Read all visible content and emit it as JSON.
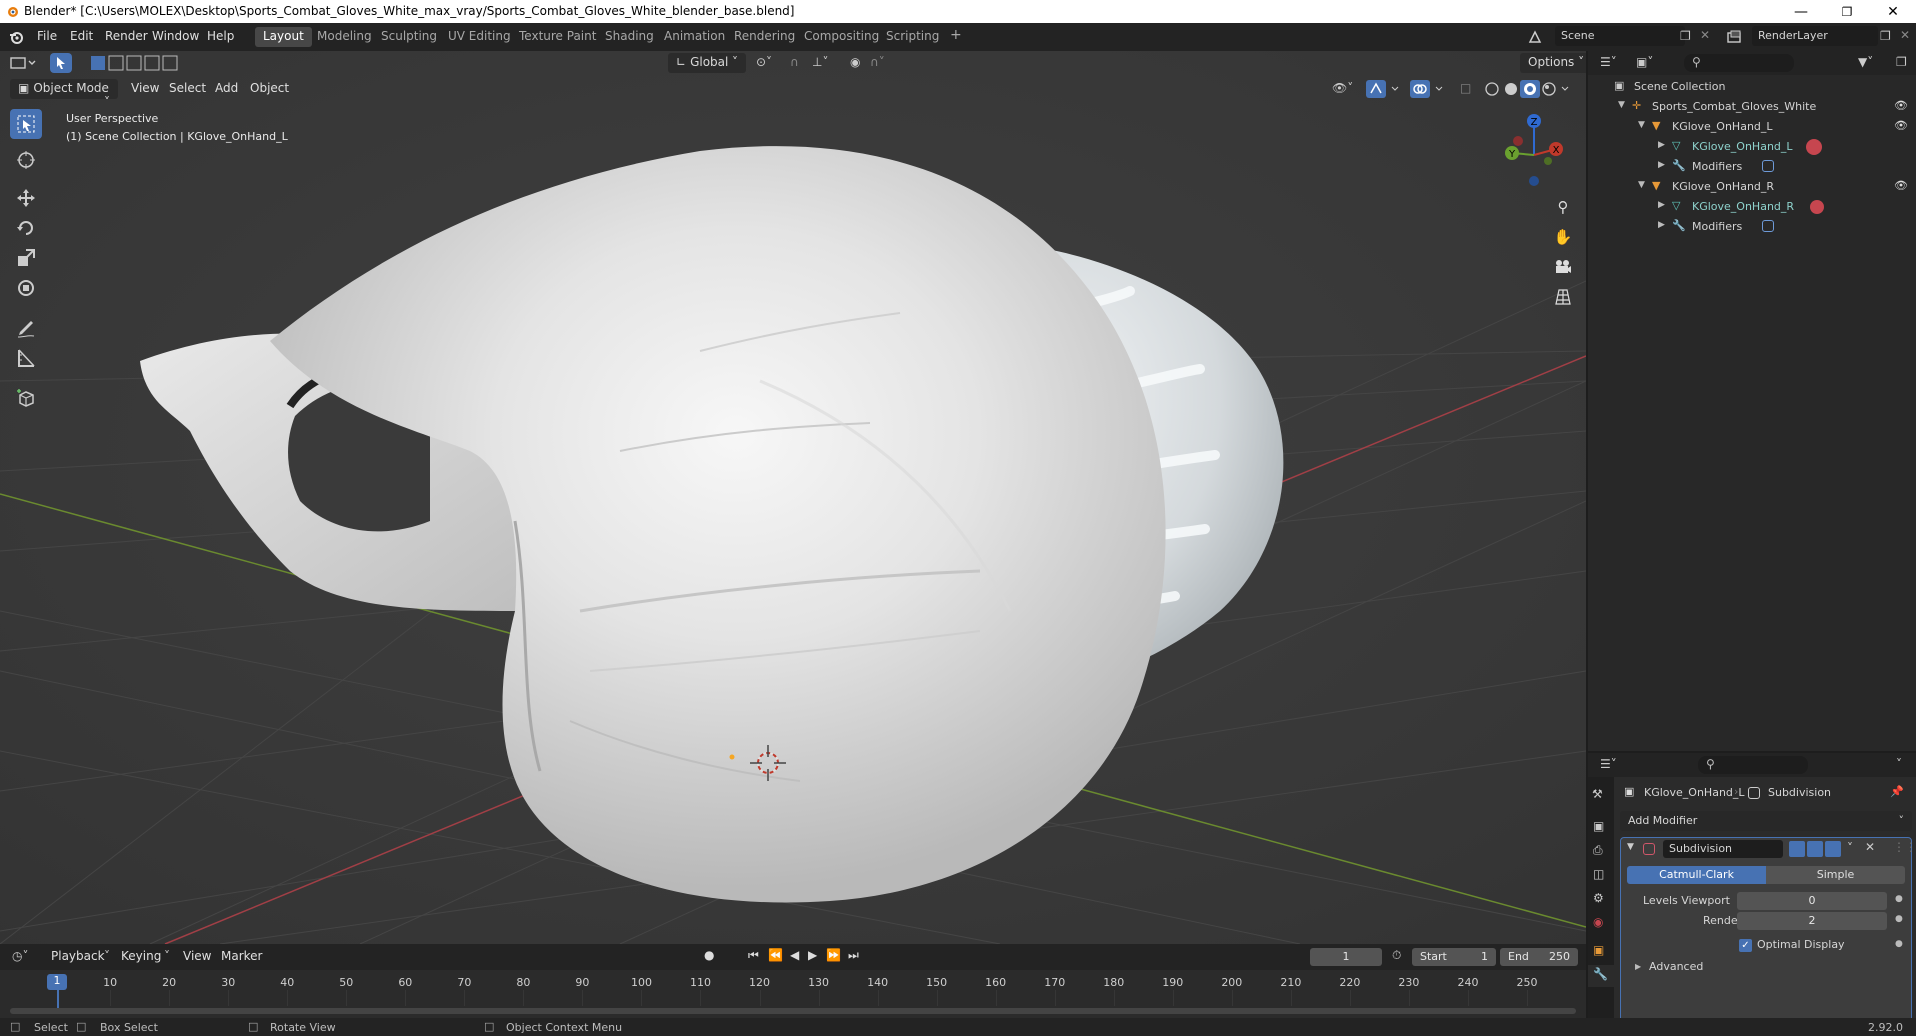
{
  "window": {
    "title": "Blender* [C:\\Users\\MOLEX\\Desktop\\Sports_Combat_Gloves_White_max_vray/Sports_Combat_Gloves_White_blender_base.blend]"
  },
  "menu": {
    "items": [
      "File",
      "Edit",
      "Render",
      "Window",
      "Help"
    ]
  },
  "workspaces": {
    "tabs": [
      "Layout",
      "Modeling",
      "Sculpting",
      "UV Editing",
      "Texture Paint",
      "Shading",
      "Animation",
      "Rendering",
      "Compositing",
      "Scripting"
    ],
    "active": "Layout",
    "add_label": "+"
  },
  "scene": {
    "label": "Scene",
    "view_layer": "RenderLayer"
  },
  "viewport": {
    "mode": "Object Mode",
    "menus": [
      "View",
      "Select",
      "Add",
      "Object"
    ],
    "orientation": "Global",
    "options_label": "Options",
    "overlay_line1": "User Perspective",
    "overlay_line2": "(1) Scene Collection | KGlove_OnHand_L",
    "gizmo_axes": {
      "z": "Z",
      "y": "Y",
      "x": "X"
    },
    "colors": {
      "background": "#393939",
      "grid": "#474747",
      "x_axis": "#a13f46",
      "y_axis": "#6a8a2f",
      "active_tool": "#4772b3"
    }
  },
  "outliner": {
    "root": "Scene Collection",
    "items": [
      {
        "label": "Sports_Combat_Gloves_White",
        "depth": 1,
        "type": "empty"
      },
      {
        "label": "KGlove_OnHand_L",
        "depth": 2,
        "type": "object"
      },
      {
        "label": "KGlove_OnHand_L",
        "depth": 3,
        "type": "mesh"
      },
      {
        "label": "Modifiers",
        "depth": 3,
        "type": "modifiers"
      },
      {
        "label": "KGlove_OnHand_R",
        "depth": 2,
        "type": "object"
      },
      {
        "label": "KGlove_OnHand_R",
        "depth": 3,
        "type": "mesh"
      },
      {
        "label": "Modifiers",
        "depth": 3,
        "type": "modifiers"
      }
    ]
  },
  "properties": {
    "object_name": "KGlove_OnHand_L",
    "modifier_context": "Subdivision",
    "add_modifier_label": "Add Modifier",
    "modifier": {
      "name": "Subdivision",
      "type_options": [
        "Catmull-Clark",
        "Simple"
      ],
      "selected_type": "Catmull-Clark",
      "levels_viewport_label": "Levels Viewport",
      "levels_viewport_value": "0",
      "render_label": "Render",
      "render_value": "2",
      "optimal_display_label": "Optimal Display",
      "optimal_display_checked": true,
      "advanced_label": "Advanced"
    }
  },
  "timeline": {
    "menus": [
      "Playback",
      "Keying",
      "View",
      "Marker"
    ],
    "current_frame": "1",
    "start_label": "Start",
    "start_value": "1",
    "end_label": "End",
    "end_value": "250",
    "ticks": [
      "1",
      "10",
      "20",
      "30",
      "40",
      "50",
      "60",
      "70",
      "80",
      "90",
      "100",
      "110",
      "120",
      "130",
      "140",
      "150",
      "160",
      "170",
      "180",
      "190",
      "200",
      "210",
      "220",
      "230",
      "240",
      "250"
    ]
  },
  "statusbar": {
    "select": "Select",
    "box_select": "Box Select",
    "rotate_view": "Rotate View",
    "context_menu": "Object Context Menu",
    "version": "2.92.0"
  }
}
